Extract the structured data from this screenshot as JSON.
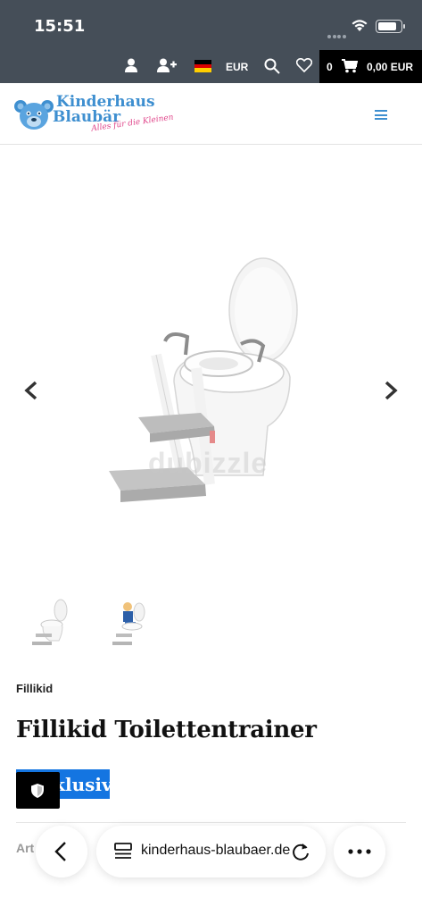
{
  "status_bar": {
    "time": "15:51"
  },
  "shop_bar": {
    "currency": "EUR",
    "cart_count": "0",
    "cart_total": "0,00 EUR",
    "icons": [
      "user-icon",
      "add-user-icon",
      "german-flag-icon",
      "search-icon",
      "heart-icon",
      "cart-icon"
    ]
  },
  "header": {
    "logo_line1": "Kinderhaus",
    "logo_line2": "Blaubär",
    "logo_tagline": "Alles für die Kleinen",
    "menu_icon": "hamburger-icon"
  },
  "gallery": {
    "watermark": "dubizzle",
    "prev_icon": "chevron-left-icon",
    "next_icon": "chevron-right-icon"
  },
  "product": {
    "brand": "Fillikid",
    "title": "Fillikid Toilettentrainer",
    "badge": "Exklusiv",
    "artnr_label": "Art"
  },
  "browser": {
    "url": "kinderhaus-blaubaer.de"
  },
  "colors": {
    "topbar": "#454e58",
    "accent": "#3e8fd0",
    "badge": "#1475e1",
    "tagline": "#e0458a"
  }
}
